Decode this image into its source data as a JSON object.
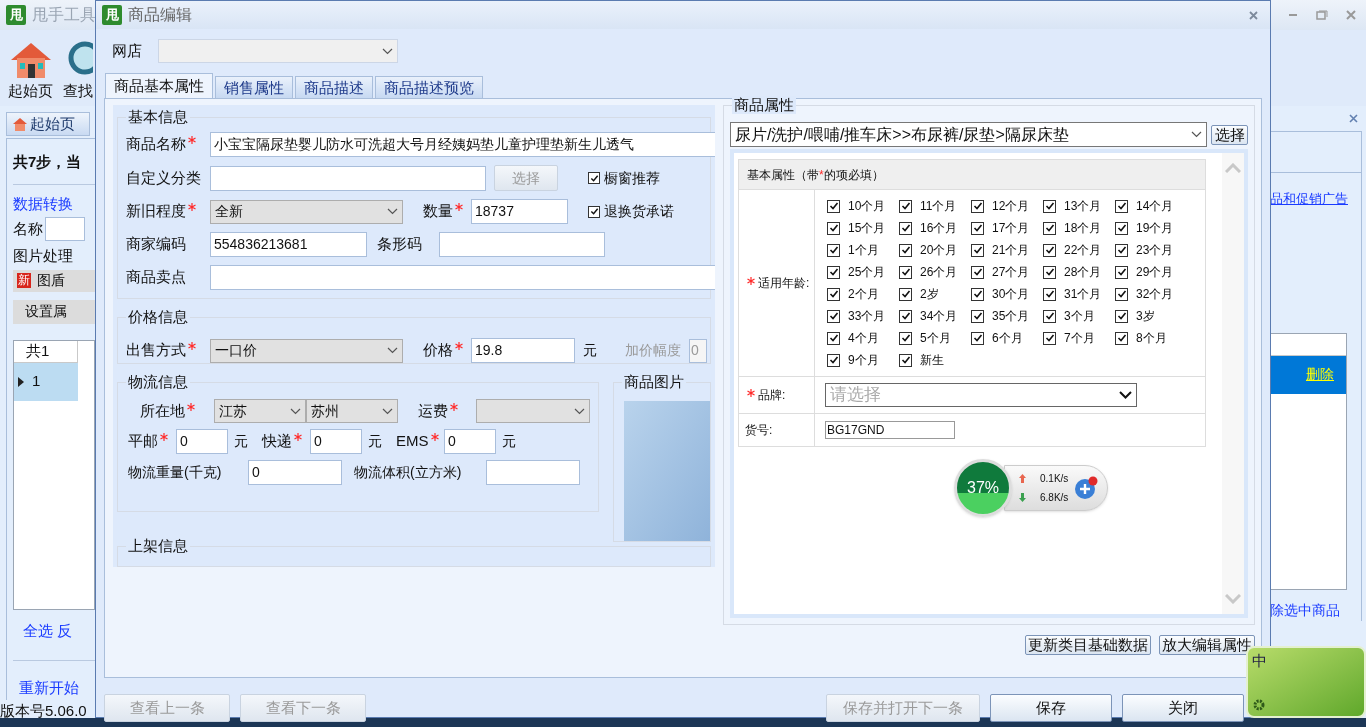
{
  "background_window": {
    "logo": "甩",
    "title": "甩手工具",
    "toolbar": [
      {
        "label": "起始页",
        "kind": "home"
      },
      {
        "label": "查找",
        "kind": "search"
      }
    ],
    "tab": "起始页",
    "step_text": "共7步，当",
    "convert_link": "数据转换",
    "name_label": "名称",
    "image_group": "图片处理",
    "new_badge": "新",
    "image_button": "图盾",
    "set_button": "设置属",
    "grid_header": "共1",
    "grid_row": {
      "number": "1",
      "selected": true
    },
    "select_links": "全选 反",
    "restart_link": "重新开始",
    "version": "版本号5.06.0",
    "promo_link": "品和促销广告",
    "delete_link": "删除",
    "remove_selected_link": "除选中商品"
  },
  "dialog": {
    "logo": "甩",
    "title": "商品编辑",
    "shop": {
      "label": "网店",
      "disabled": true
    },
    "tabs": [
      {
        "label": "商品基本属性",
        "selected": true
      },
      {
        "label": "销售属性",
        "selected": false
      },
      {
        "label": "商品描述",
        "selected": false
      },
      {
        "label": "商品描述预览",
        "selected": false
      }
    ],
    "basic_info": {
      "title": "基本信息",
      "name": {
        "label": "商品名称",
        "required": true,
        "value": "小宝宝隔尿垫婴儿防水可洗超大号月经姨妈垫儿童护理垫新生儿透气"
      },
      "custom_category": {
        "label": "自定义分类",
        "required": false,
        "button": "选择",
        "button_disabled": true
      },
      "window_recommend": {
        "label": "橱窗推荐",
        "checked": true
      },
      "condition": {
        "label": "新旧程度",
        "required": true,
        "value": "全新"
      },
      "quantity": {
        "label": "数量",
        "required": true,
        "value": "18737"
      },
      "return_promise": {
        "label": "退换货承诺",
        "checked": true
      },
      "merchant_code": {
        "label": "商家编码",
        "required": false,
        "value": "554836213681"
      },
      "barcode": {
        "label": "条形码",
        "required": false
      },
      "selling_point": {
        "label": "商品卖点",
        "required": false
      }
    },
    "price_info": {
      "title": "价格信息",
      "sale_method": {
        "label": "出售方式",
        "required": true,
        "value": "一口价"
      },
      "price": {
        "label": "价格",
        "required": true,
        "value": "19.8",
        "unit": "元"
      },
      "increment": {
        "label": "加价幅度",
        "value": "0",
        "disabled": true
      }
    },
    "logistics": {
      "title": "物流信息",
      "location": {
        "label": "所在地",
        "required": true,
        "province": "江苏",
        "city": "苏州"
      },
      "freight": {
        "label": "运费",
        "required": true
      },
      "fees": [
        {
          "label": "平邮",
          "required": true,
          "value": "0",
          "unit": "元"
        },
        {
          "label": "快递",
          "required": true,
          "value": "0",
          "unit": "元"
        },
        {
          "label": "EMS",
          "required": true,
          "value": "0",
          "unit": "元"
        }
      ],
      "weight": {
        "label": "物流重量(千克)",
        "value": "0"
      },
      "volume": {
        "label": "物流体积(立方米)"
      }
    },
    "product_image": {
      "title": "商品图片"
    },
    "listing": {
      "title": "上架信息"
    },
    "attributes": {
      "title": "商品属性",
      "category": "尿片/洗护/喂哺/推车床>>布尿裤/尿垫>隔尿床垫",
      "choose_button": "选择",
      "table_title": {
        "start": "基本属性（带",
        "mark": "*",
        "end": " 的项必填）"
      },
      "age": {
        "label": "适用年龄:",
        "required": true,
        "options": [
          {
            "label": "10个月",
            "checked": true
          },
          {
            "label": "11个月",
            "checked": true
          },
          {
            "label": "12个月",
            "checked": true
          },
          {
            "label": "13个月",
            "checked": true
          },
          {
            "label": "14个月",
            "checked": true
          },
          {
            "label": "15个月",
            "checked": true
          },
          {
            "label": "16个月",
            "checked": true
          },
          {
            "label": "17个月",
            "checked": true
          },
          {
            "label": "18个月",
            "checked": true
          },
          {
            "label": "19个月",
            "checked": true
          },
          {
            "label": "1个月",
            "checked": true
          },
          {
            "label": "20个月",
            "checked": true
          },
          {
            "label": "21个月",
            "checked": true
          },
          {
            "label": "22个月",
            "checked": true
          },
          {
            "label": "23个月",
            "checked": true
          },
          {
            "label": "25个月",
            "checked": true
          },
          {
            "label": "26个月",
            "checked": true
          },
          {
            "label": "27个月",
            "checked": true
          },
          {
            "label": "28个月",
            "checked": true
          },
          {
            "label": "29个月",
            "checked": true
          },
          {
            "label": "2个月",
            "checked": true
          },
          {
            "label": "2岁",
            "checked": true
          },
          {
            "label": "30个月",
            "checked": true
          },
          {
            "label": "31个月",
            "checked": true
          },
          {
            "label": "32个月",
            "checked": true
          },
          {
            "label": "33个月",
            "checked": true
          },
          {
            "label": "34个月",
            "checked": true
          },
          {
            "label": "35个月",
            "checked": true
          },
          {
            "label": "3个月",
            "checked": true
          },
          {
            "label": "3岁",
            "checked": true
          },
          {
            "label": "4个月",
            "checked": true
          },
          {
            "label": "5个月",
            "checked": true
          },
          {
            "label": "6个月",
            "checked": true
          },
          {
            "label": "7个月",
            "checked": true
          },
          {
            "label": "8个月",
            "checked": true
          },
          {
            "label": "9个月",
            "checked": true
          },
          {
            "label": "新生",
            "checked": true
          }
        ]
      },
      "brand": {
        "label": "品牌:",
        "required": true,
        "placeholder": "请选择"
      },
      "item_number": {
        "label": "货号:",
        "required": false,
        "value": "BG17GND"
      }
    },
    "attribute_buttons": [
      "更新类目基础数据",
      "放大编辑属性"
    ],
    "footer_buttons": [
      {
        "label": "查看上一条",
        "disabled": true
      },
      {
        "label": "查看下一条",
        "disabled": true
      },
      {
        "label": "保存并打开下一条",
        "disabled": true
      },
      {
        "label": "保存",
        "disabled": false
      },
      {
        "label": "关闭",
        "disabled": false
      }
    ]
  },
  "speed_widget": {
    "percent": "37%",
    "upload": "0.1K/s",
    "download": "6.8K/s"
  },
  "ime": {
    "label": "中"
  }
}
